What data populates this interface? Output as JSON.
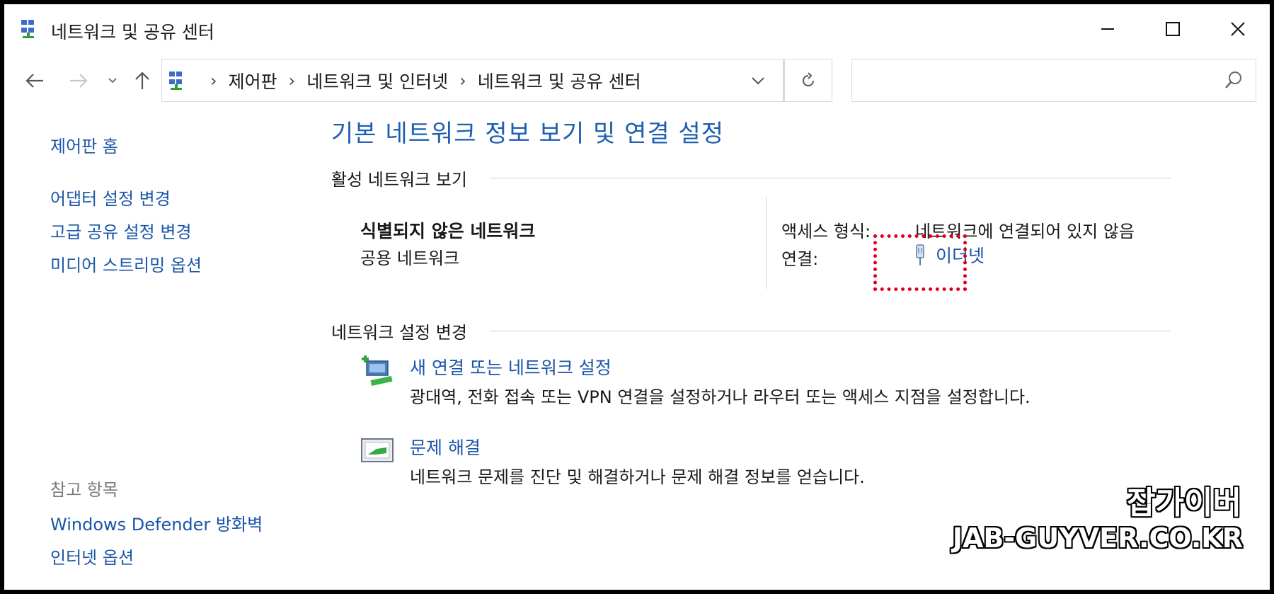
{
  "window": {
    "title": "네트워크 및 공유 센터",
    "icon": "network-icon",
    "controls": [
      "minimize-icon",
      "maximize-icon",
      "close-icon"
    ]
  },
  "nav": {
    "back_icon": "arrow-left-icon",
    "forward_icon": "arrow-right-icon",
    "recent_icon": "chevron-down-icon",
    "up_icon": "arrow-up-icon"
  },
  "address": {
    "breadcrumb": [
      "제어판",
      "네트워크 및 인터넷",
      "네트워크 및 공유 센터"
    ],
    "refresh_icon": "refresh-icon"
  },
  "search": {
    "placeholder": "",
    "value": "",
    "icon": "search-icon"
  },
  "sidebar": {
    "home": "제어판 홈",
    "items": [
      "어댑터 설정 변경",
      "고급 공유 설정 변경",
      "미디어 스트리밍 옵션"
    ],
    "see_also_heading": "참고 항목",
    "see_also": [
      "Windows Defender 방화벽",
      "인터넷 옵션"
    ]
  },
  "main": {
    "title": "기본 네트워크 정보 보기 및 연결 설정",
    "active_section": "활성 네트워크 보기",
    "network_name": "식별되지 않은 네트워크",
    "network_type": "공용 네트워크",
    "access_label": "액세스 형식:",
    "access_value": "네트워크에 연결되어 있지 않음",
    "connection_label": "연결:",
    "connection_value": "이더넷",
    "change_section": "네트워크 설정 변경",
    "tasks": [
      {
        "title": "새 연결 또는 네트워크 설정",
        "desc": "광대역, 전화 접속 또는 VPN 연결을 설정하거나 라우터 또는 액세스 지점을 설정합니다.",
        "icon": "new-connection-icon"
      },
      {
        "title": "문제 해결",
        "desc": "네트워크 문제를 진단 및 해결하거나 문제 해결 정보를 얻습니다.",
        "icon": "troubleshoot-icon"
      }
    ]
  },
  "annotation": {
    "highlight_color": "#e0001b"
  },
  "watermark": {
    "line1": "잡가이버",
    "line2": "JAB-GUYVER.CO.KR"
  },
  "colors": {
    "link": "#1a56a8",
    "heading": "#1e5fb0"
  }
}
